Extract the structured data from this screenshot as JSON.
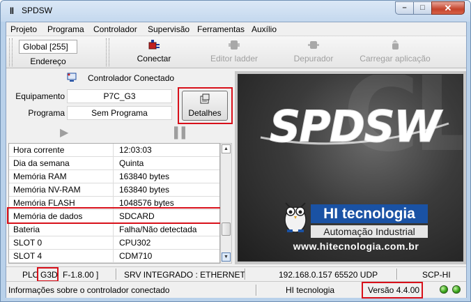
{
  "window": {
    "title": "SPDSW",
    "min_label": "–",
    "max_label": "□",
    "close_label": "✕"
  },
  "menu": [
    "Projeto",
    "Programa",
    "Controlador",
    "Supervisão",
    "Ferramentas",
    "Auxílio"
  ],
  "toolbar": {
    "address_value": "Global [255]",
    "address_label": "Endereço",
    "buttons": [
      {
        "label": "Conectar",
        "icon": "plug-icon",
        "enabled": true
      },
      {
        "label": "Editor ladder",
        "icon": "ladder-icon",
        "enabled": false
      },
      {
        "label": "Depurador",
        "icon": "debugger-icon",
        "enabled": false
      },
      {
        "label": "Carregar aplicação",
        "icon": "upload-icon",
        "enabled": false
      }
    ]
  },
  "controller": {
    "status": "Controlador Conectado",
    "equipment_label": "Equipamento",
    "equipment_value": "P7C_G3",
    "program_label": "Programa",
    "program_value": "Sem Programa",
    "details_label": "Detalhes"
  },
  "info_rows": [
    {
      "key": "Hora corrente",
      "value": "12:03:03"
    },
    {
      "key": "Dia da semana",
      "value": "Quinta"
    },
    {
      "key": "Memória RAM",
      "value": "163840 bytes"
    },
    {
      "key": "Memória NV-RAM",
      "value": "163840 bytes"
    },
    {
      "key": "Memória FLASH",
      "value": "1048576 bytes"
    },
    {
      "key": "Memória de dados",
      "value": "SDCARD"
    },
    {
      "key": "Bateria",
      "value": "Falha/Não detectada"
    },
    {
      "key": "SLOT 0",
      "value": "CPU302"
    },
    {
      "key": "SLOT 4",
      "value": "CDM710"
    }
  ],
  "logo": {
    "product": "SPDSW",
    "company": "HI tecnologia",
    "tagline": "Automação Industrial",
    "url": "www.hitecnologia.com.br"
  },
  "statusbar": {
    "plc_prefix": "PLC",
    "plc_model": "G3D",
    "firmware": "F-1.8.00 ]",
    "server": "SRV INTEGRADO : ETHERNET",
    "address": "192.168.0.157 65520 UDP",
    "protocol": "SCP-HI",
    "hint": "Informações sobre o controlador conectado",
    "company": "HI tecnologia",
    "version": "Versão 4.4.00"
  },
  "colors": {
    "highlight": "#d8101a",
    "led": "#3aa71a",
    "brand_blue": "#1a52a4"
  }
}
